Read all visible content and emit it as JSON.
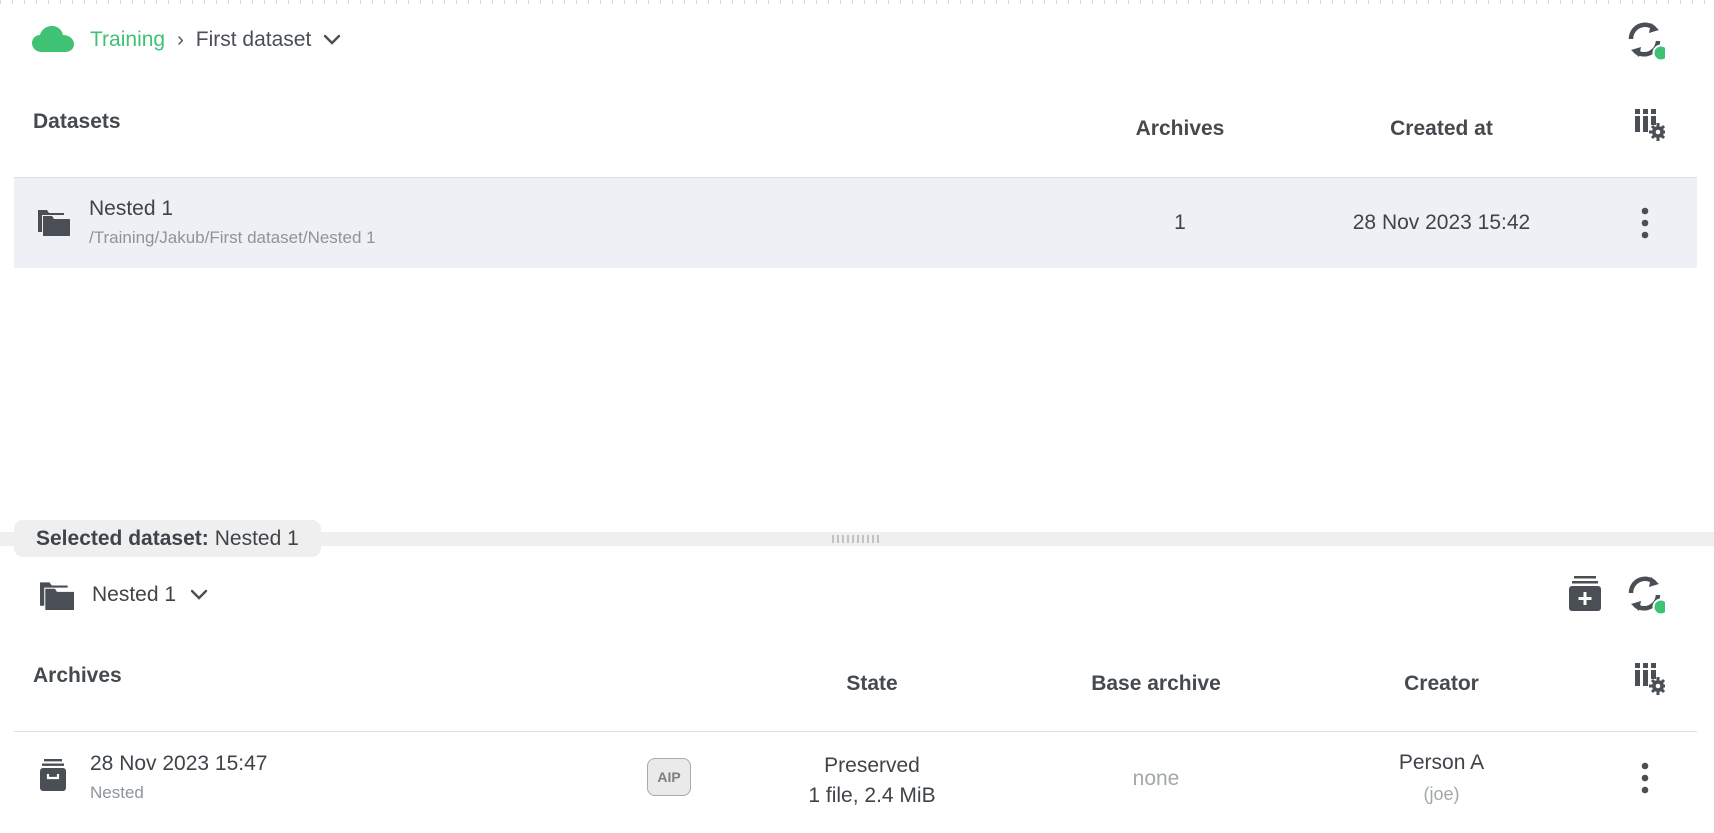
{
  "breadcrumb": {
    "root": "Training",
    "separator": "›",
    "current": "First dataset"
  },
  "datasets_table": {
    "title": "Datasets",
    "columns": {
      "archives": "Archives",
      "created_at": "Created at"
    },
    "rows": [
      {
        "name": "Nested 1",
        "path": "/Training/Jakub/First dataset/Nested 1",
        "archives": "1",
        "created_at": "28 Nov 2023 15:42"
      }
    ]
  },
  "selected_tab": {
    "label": "Selected dataset:",
    "value": "Nested 1"
  },
  "selected_dataset": {
    "name": "Nested 1"
  },
  "archives_table": {
    "title": "Archives",
    "columns": {
      "state": "State",
      "base_archive": "Base archive",
      "creator": "Creator"
    },
    "rows": [
      {
        "name": "28 Nov 2023 15:47",
        "description": "Nested",
        "badge": "AIP",
        "state": "Preserved",
        "state_detail": "1 file, 2.4 MiB",
        "base_archive": "none",
        "creator_name": "Person A",
        "creator_login": "(joe)"
      }
    ]
  },
  "colors": {
    "brand_green": "#3fc274",
    "icon_dark": "#4a4f55",
    "selected_row_bg": "#eef0f5"
  },
  "icons": {
    "brand": "cloud-icon",
    "refresh": "refresh-icon",
    "columns_config": "column-settings-icon",
    "dataset": "folder-stack-icon",
    "archive": "archive-box-icon",
    "create_archive": "add-archive-icon",
    "menu": "kebab-menu-icon",
    "dropdown": "chevron-down-icon"
  }
}
